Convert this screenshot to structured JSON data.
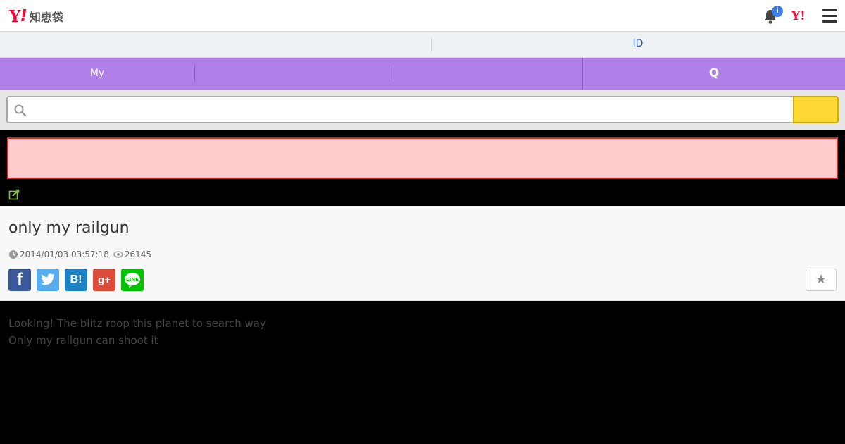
{
  "header": {
    "logo_y": "Y",
    "logo_ex": "!",
    "logo_text": "知恵袋",
    "notification_badge": "i",
    "yahoo_mark": "Y!"
  },
  "idbar": {
    "id_link": "ID"
  },
  "nav": {
    "tabs": [
      {
        "label": "My"
      },
      {
        "label": ""
      },
      {
        "label": ""
      },
      {
        "label": "Q"
      }
    ]
  },
  "search": {
    "value": "",
    "placeholder": ""
  },
  "question": {
    "title": "only my railgun",
    "date": "2014/01/03 03:57:18",
    "views": "26145"
  },
  "share": {
    "facebook": "f",
    "hatena": "B!",
    "googleplus": "g+"
  },
  "favorite": {
    "star": "★"
  },
  "body": {
    "lines": [
      "Looking! The blitz roop this planet to search way",
      "Only my railgun can shoot it"
    ]
  },
  "colors": {
    "nav_bg": "#b07fe8",
    "search_button": "#fdd835",
    "alert_bg": "#ffcccc",
    "alert_border": "#d8242b",
    "yahoo_red": "#ff0033"
  }
}
